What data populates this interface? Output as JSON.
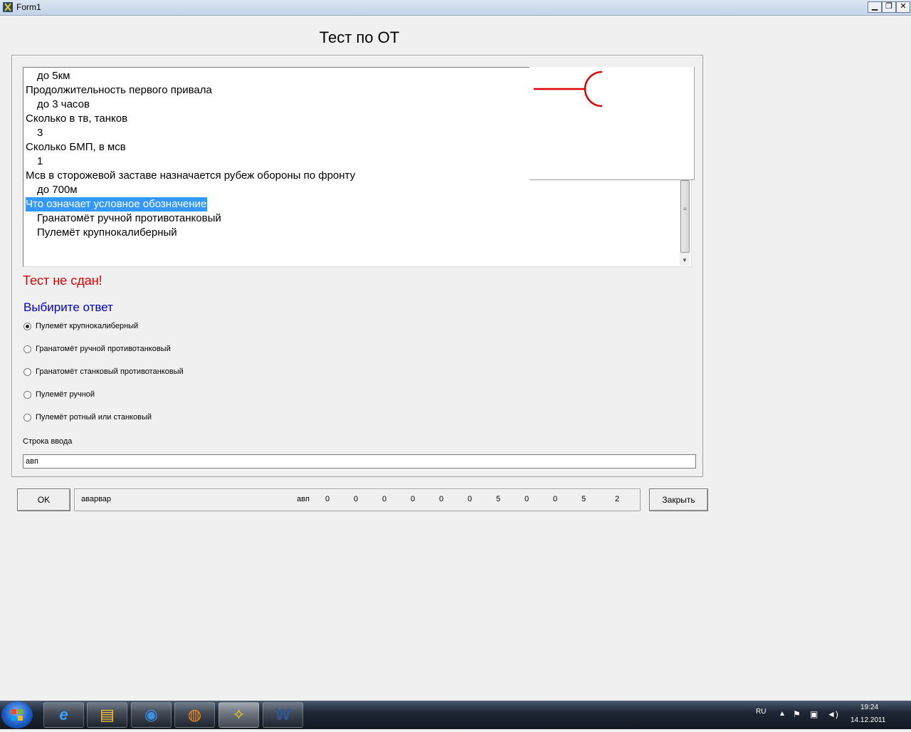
{
  "window": {
    "title": "Form1"
  },
  "form": {
    "title": "Тест по ОТ",
    "memo_lines": [
      {
        "text": "до 5км",
        "indent": true,
        "selected": false
      },
      {
        "text": "Продолжительность первого привала",
        "indent": false,
        "selected": false
      },
      {
        "text": "до 3 часов",
        "indent": true,
        "selected": false
      },
      {
        "text": "Сколько в тв, танков",
        "indent": false,
        "selected": false
      },
      {
        "text": "3",
        "indent": true,
        "selected": false
      },
      {
        "text": "Сколько БМП, в мсв",
        "indent": false,
        "selected": false
      },
      {
        "text": "1",
        "indent": true,
        "selected": false
      },
      {
        "text": "Мсв в сторожевой заставе назначается рубеж обороны по фронту",
        "indent": false,
        "selected": false
      },
      {
        "text": "до 700м",
        "indent": true,
        "selected": false
      },
      {
        "text": "Что означает условное обозначение",
        "indent": false,
        "selected": true
      },
      {
        "text": "Гранатомёт ручной противотанковый",
        "indent": true,
        "selected": false
      },
      {
        "text": "Пулемёт крупнокалиберный",
        "indent": true,
        "selected": false
      }
    ],
    "result_text": "Тест не сдан!",
    "prompt_text": "Выбирите ответ",
    "options": [
      {
        "label": "Пулемёт крупнокалиберный",
        "checked": true
      },
      {
        "label": "Гранатомёт ручной противотанковый",
        "checked": false
      },
      {
        "label": "Гранатомёт станковый противотанковый",
        "checked": false
      },
      {
        "label": "Пулемёт ручной",
        "checked": false
      },
      {
        "label": "Пулемёт ротный или станковый",
        "checked": false
      }
    ],
    "input_label": "Строка ввода",
    "input_value": "авп",
    "ok_label": "OK",
    "close_label": "Закрыть",
    "status": {
      "name": "аварвар",
      "input_echo": "авп",
      "numbers": [
        "0",
        "0",
        "0",
        "0",
        "0",
        "0",
        "5",
        "0",
        "0",
        "5",
        "2"
      ]
    }
  },
  "colors": {
    "result": "#e00000",
    "prompt": "#0000c8",
    "symbol": "#e00000",
    "selection": "#3399ff"
  },
  "taskbar": {
    "icons": [
      "start-orb-icon",
      "internet-explorer-icon",
      "file-explorer-icon",
      "media-player-icon",
      "firefox-icon",
      "delphi-app-icon",
      "word-icon"
    ],
    "tray_language": "RU",
    "time": "19:24",
    "date": "14.12.2011"
  }
}
